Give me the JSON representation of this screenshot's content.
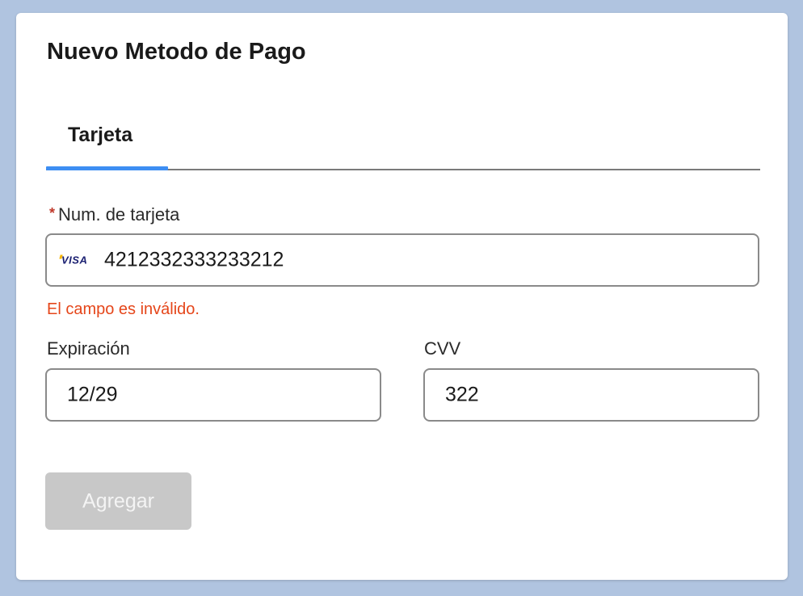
{
  "form": {
    "title": "Nuevo Metodo de Pago",
    "tabs": [
      {
        "label": "Tarjeta",
        "active": true
      }
    ],
    "card_number": {
      "required_marker": "*",
      "label": "Num. de tarjeta",
      "value": "4212332333233212",
      "brand_icon": "VISA",
      "error": "El campo es inválido."
    },
    "expiration": {
      "label": "Expiración",
      "value": "12/29"
    },
    "cvv": {
      "label": "CVV",
      "value": "322"
    },
    "submit": {
      "label": "Agregar",
      "disabled": true
    }
  },
  "colors": {
    "background": "#b0c4e0",
    "tab_indicator": "#3d8ef3",
    "error": "#e5461a",
    "required": "#c0392b",
    "disabled_button": "#c8c8c8"
  }
}
